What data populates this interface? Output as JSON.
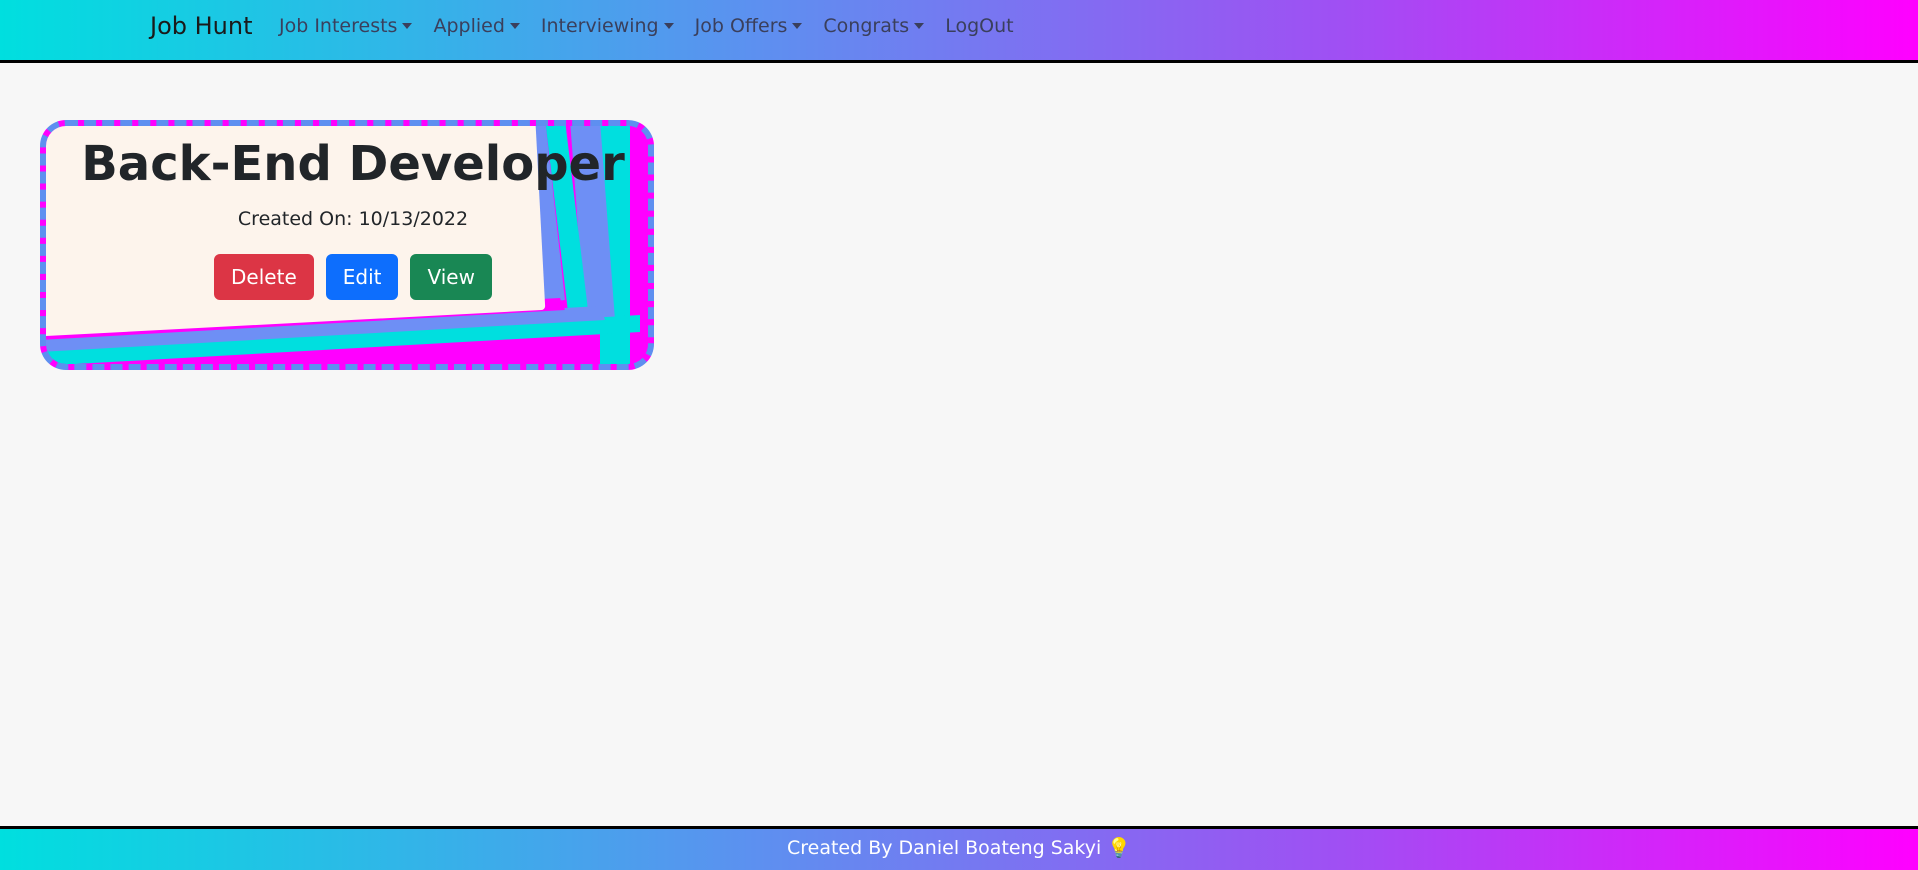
{
  "navbar": {
    "brand": "Job Hunt",
    "items": [
      {
        "label": "Job Interests",
        "dropdown": true
      },
      {
        "label": "Applied",
        "dropdown": true
      },
      {
        "label": "Interviewing",
        "dropdown": true
      },
      {
        "label": "Job Offers",
        "dropdown": true
      },
      {
        "label": "Congrats",
        "dropdown": true
      },
      {
        "label": "LogOut",
        "dropdown": false
      }
    ]
  },
  "card": {
    "title": "Back-End Developer",
    "created_on": "Created On: 10/13/2022",
    "buttons": {
      "delete": "Delete",
      "edit": "Edit",
      "view": "View"
    }
  },
  "footer": {
    "text": "Created By Daniel Boateng Sakyi",
    "icon": "lightbulb-icon",
    "icon_glyph": "💡"
  },
  "colors": {
    "gradient_start": "#00dfdf",
    "gradient_mid": "#5e8ff0",
    "gradient_end": "#ff00ff",
    "delete": "#dc3545",
    "edit": "#0d6efd",
    "view": "#198754"
  }
}
